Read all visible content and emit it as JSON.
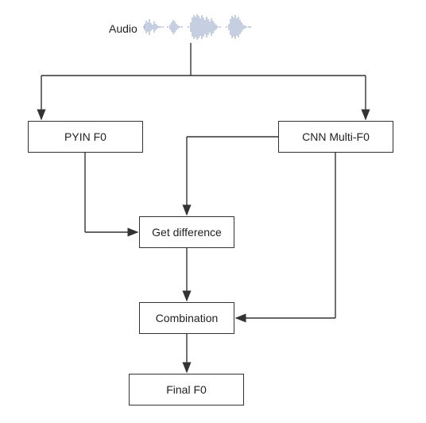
{
  "chart_data": {
    "type": "flow-diagram",
    "nodes": [
      {
        "id": "audio",
        "label": "Audio",
        "kind": "input-label"
      },
      {
        "id": "pyin",
        "label": "PYIN F0",
        "kind": "process"
      },
      {
        "id": "cnn",
        "label": "CNN Multi-F0",
        "kind": "process"
      },
      {
        "id": "diff",
        "label": "Get difference",
        "kind": "process"
      },
      {
        "id": "comb",
        "label": "Combination",
        "kind": "process"
      },
      {
        "id": "final",
        "label": "Final F0",
        "kind": "output"
      }
    ],
    "edges": [
      {
        "from": "audio",
        "to": "pyin"
      },
      {
        "from": "audio",
        "to": "cnn"
      },
      {
        "from": "pyin",
        "to": "diff"
      },
      {
        "from": "cnn",
        "to": "diff"
      },
      {
        "from": "cnn",
        "to": "comb"
      },
      {
        "from": "diff",
        "to": "comb"
      },
      {
        "from": "comb",
        "to": "final"
      }
    ],
    "title": ""
  },
  "labels": {
    "audio": "Audio",
    "pyin": "PYIN F0",
    "cnn": "CNN Multi-F0",
    "diff": "Get difference",
    "comb": "Combination",
    "final": "Final F0"
  }
}
